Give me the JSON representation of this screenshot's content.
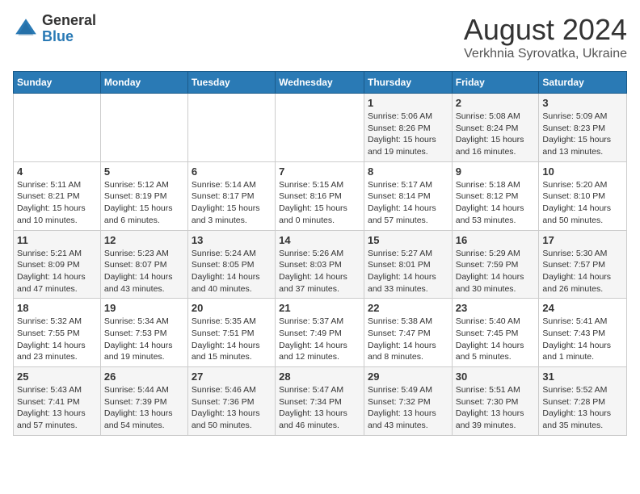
{
  "logo": {
    "general": "General",
    "blue": "Blue"
  },
  "title": "August 2024",
  "subtitle": "Verkhnia Syrovatka, Ukraine",
  "headers": [
    "Sunday",
    "Monday",
    "Tuesday",
    "Wednesday",
    "Thursday",
    "Friday",
    "Saturday"
  ],
  "weeks": [
    [
      {
        "day": "",
        "info": ""
      },
      {
        "day": "",
        "info": ""
      },
      {
        "day": "",
        "info": ""
      },
      {
        "day": "",
        "info": ""
      },
      {
        "day": "1",
        "info": "Sunrise: 5:06 AM\nSunset: 8:26 PM\nDaylight: 15 hours\nand 19 minutes."
      },
      {
        "day": "2",
        "info": "Sunrise: 5:08 AM\nSunset: 8:24 PM\nDaylight: 15 hours\nand 16 minutes."
      },
      {
        "day": "3",
        "info": "Sunrise: 5:09 AM\nSunset: 8:23 PM\nDaylight: 15 hours\nand 13 minutes."
      }
    ],
    [
      {
        "day": "4",
        "info": "Sunrise: 5:11 AM\nSunset: 8:21 PM\nDaylight: 15 hours\nand 10 minutes."
      },
      {
        "day": "5",
        "info": "Sunrise: 5:12 AM\nSunset: 8:19 PM\nDaylight: 15 hours\nand 6 minutes."
      },
      {
        "day": "6",
        "info": "Sunrise: 5:14 AM\nSunset: 8:17 PM\nDaylight: 15 hours\nand 3 minutes."
      },
      {
        "day": "7",
        "info": "Sunrise: 5:15 AM\nSunset: 8:16 PM\nDaylight: 15 hours\nand 0 minutes."
      },
      {
        "day": "8",
        "info": "Sunrise: 5:17 AM\nSunset: 8:14 PM\nDaylight: 14 hours\nand 57 minutes."
      },
      {
        "day": "9",
        "info": "Sunrise: 5:18 AM\nSunset: 8:12 PM\nDaylight: 14 hours\nand 53 minutes."
      },
      {
        "day": "10",
        "info": "Sunrise: 5:20 AM\nSunset: 8:10 PM\nDaylight: 14 hours\nand 50 minutes."
      }
    ],
    [
      {
        "day": "11",
        "info": "Sunrise: 5:21 AM\nSunset: 8:09 PM\nDaylight: 14 hours\nand 47 minutes."
      },
      {
        "day": "12",
        "info": "Sunrise: 5:23 AM\nSunset: 8:07 PM\nDaylight: 14 hours\nand 43 minutes."
      },
      {
        "day": "13",
        "info": "Sunrise: 5:24 AM\nSunset: 8:05 PM\nDaylight: 14 hours\nand 40 minutes."
      },
      {
        "day": "14",
        "info": "Sunrise: 5:26 AM\nSunset: 8:03 PM\nDaylight: 14 hours\nand 37 minutes."
      },
      {
        "day": "15",
        "info": "Sunrise: 5:27 AM\nSunset: 8:01 PM\nDaylight: 14 hours\nand 33 minutes."
      },
      {
        "day": "16",
        "info": "Sunrise: 5:29 AM\nSunset: 7:59 PM\nDaylight: 14 hours\nand 30 minutes."
      },
      {
        "day": "17",
        "info": "Sunrise: 5:30 AM\nSunset: 7:57 PM\nDaylight: 14 hours\nand 26 minutes."
      }
    ],
    [
      {
        "day": "18",
        "info": "Sunrise: 5:32 AM\nSunset: 7:55 PM\nDaylight: 14 hours\nand 23 minutes."
      },
      {
        "day": "19",
        "info": "Sunrise: 5:34 AM\nSunset: 7:53 PM\nDaylight: 14 hours\nand 19 minutes."
      },
      {
        "day": "20",
        "info": "Sunrise: 5:35 AM\nSunset: 7:51 PM\nDaylight: 14 hours\nand 15 minutes."
      },
      {
        "day": "21",
        "info": "Sunrise: 5:37 AM\nSunset: 7:49 PM\nDaylight: 14 hours\nand 12 minutes."
      },
      {
        "day": "22",
        "info": "Sunrise: 5:38 AM\nSunset: 7:47 PM\nDaylight: 14 hours\nand 8 minutes."
      },
      {
        "day": "23",
        "info": "Sunrise: 5:40 AM\nSunset: 7:45 PM\nDaylight: 14 hours\nand 5 minutes."
      },
      {
        "day": "24",
        "info": "Sunrise: 5:41 AM\nSunset: 7:43 PM\nDaylight: 14 hours\nand 1 minute."
      }
    ],
    [
      {
        "day": "25",
        "info": "Sunrise: 5:43 AM\nSunset: 7:41 PM\nDaylight: 13 hours\nand 57 minutes."
      },
      {
        "day": "26",
        "info": "Sunrise: 5:44 AM\nSunset: 7:39 PM\nDaylight: 13 hours\nand 54 minutes."
      },
      {
        "day": "27",
        "info": "Sunrise: 5:46 AM\nSunset: 7:36 PM\nDaylight: 13 hours\nand 50 minutes."
      },
      {
        "day": "28",
        "info": "Sunrise: 5:47 AM\nSunset: 7:34 PM\nDaylight: 13 hours\nand 46 minutes."
      },
      {
        "day": "29",
        "info": "Sunrise: 5:49 AM\nSunset: 7:32 PM\nDaylight: 13 hours\nand 43 minutes."
      },
      {
        "day": "30",
        "info": "Sunrise: 5:51 AM\nSunset: 7:30 PM\nDaylight: 13 hours\nand 39 minutes."
      },
      {
        "day": "31",
        "info": "Sunrise: 5:52 AM\nSunset: 7:28 PM\nDaylight: 13 hours\nand 35 minutes."
      }
    ]
  ]
}
